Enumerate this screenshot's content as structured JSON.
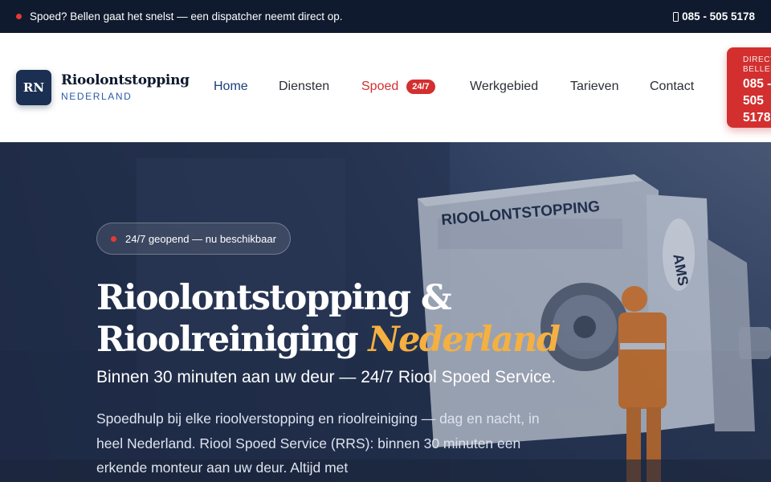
{
  "topbar": {
    "notice": "Spoed? Bellen gaat het snelst — een dispatcher neemt direct op.",
    "phone": "085 - 505 5178"
  },
  "logo": {
    "mark": "RN",
    "title": "Rioolontstopping",
    "subtitle": "NEDERLAND"
  },
  "nav": {
    "items": [
      {
        "label": "Home"
      },
      {
        "label": "Diensten"
      },
      {
        "label": "Spoed",
        "badge": "24/7"
      },
      {
        "label": "Werkgebied"
      },
      {
        "label": "Tarieven"
      },
      {
        "label": "Contact"
      }
    ]
  },
  "cta": {
    "label_line1": "DIRECT",
    "label_line2": "BELLEN",
    "number": "085 - 505 5178"
  },
  "hero": {
    "status": "24/7 geopend — nu beschikbaar",
    "title_line1": "Rioolontstopping &",
    "title_line2_plain": "Rioolreiniging",
    "title_line2_accent": "Nederland",
    "subtitle": "Binnen 30 minuten aan uw deur — 24/7 Riool Spoed Service.",
    "body": "Spoedhulp bij elke rioolverstopping en rioolreiniging — dag en nacht, in heel Nederland. Riool Spoed Service (RRS): binnen 30 minuten een erkende monteur aan uw deur. Altijd met",
    "truck_text": "RIOOLONTSTOPPING",
    "truck_brand": "AMS"
  },
  "colors": {
    "navy": "#0f1a2e",
    "brand_blue": "#1b2f52",
    "accent_red": "#d32f2f",
    "accent_gold": "#f5b041"
  },
  "icons": {
    "status_dot": "red-dot-icon",
    "phone": "phone-icon"
  }
}
